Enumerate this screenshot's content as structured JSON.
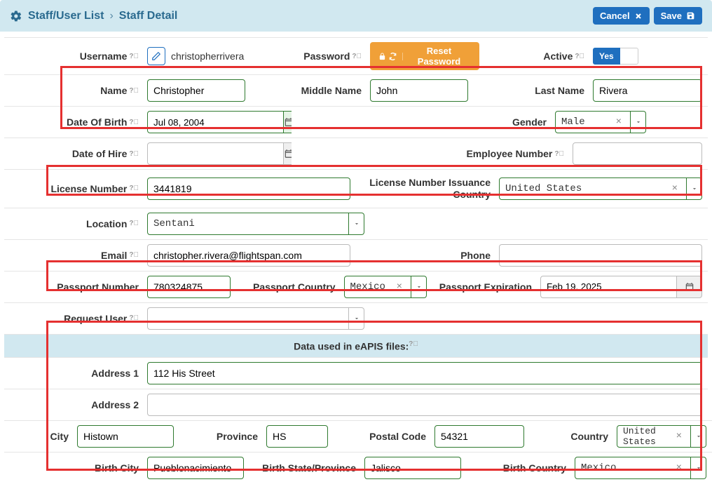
{
  "header": {
    "breadcrumb1": "Staff/User List",
    "breadcrumb2": "Staff Detail",
    "cancel": "Cancel",
    "save": "Save"
  },
  "labels": {
    "username": "Username",
    "password": "Password",
    "reset_password": "Reset Password",
    "active": "Active",
    "active_yes": "Yes",
    "name": "Name",
    "middle_name": "Middle Name",
    "last_name": "Last Name",
    "dob": "Date Of Birth",
    "gender": "Gender",
    "date_of_hire": "Date of Hire",
    "employee_number": "Employee Number",
    "license_number": "License Number",
    "license_country": "License Number Issuance Country",
    "location": "Location",
    "email": "Email",
    "phone": "Phone",
    "passport_number": "Passport Number",
    "passport_country": "Passport Country",
    "passport_expiration": "Passport Expiration",
    "request_user": "Request User",
    "eapis_header": "Data used in eAPIS files:",
    "address1": "Address 1",
    "address2": "Address 2",
    "city": "City",
    "province": "Province",
    "postal_code": "Postal Code",
    "country": "Country",
    "birth_city": "Birth City",
    "birth_state": "Birth State/Province",
    "birth_country": "Birth Country"
  },
  "values": {
    "username": "christopherrivera",
    "name": "Christopher",
    "middle_name": "John",
    "last_name": "Rivera",
    "dob": "Jul 08, 2004",
    "gender": "Male",
    "date_of_hire": "",
    "employee_number": "",
    "license_number": "3441819",
    "license_country": "United States",
    "location": "Sentani",
    "email": "christopher.rivera@flightspan.com",
    "phone": "",
    "passport_number": "780324875",
    "passport_country": "Mexico",
    "passport_expiration": "Feb 19, 2025",
    "request_user": "",
    "address1": "112 His Street",
    "address2": "",
    "city": "Histown",
    "province": "HS",
    "postal_code": "54321",
    "country": "United States",
    "birth_city": "Pueblonacimiento",
    "birth_state": "Jalisco",
    "birth_country": "Mexico"
  }
}
